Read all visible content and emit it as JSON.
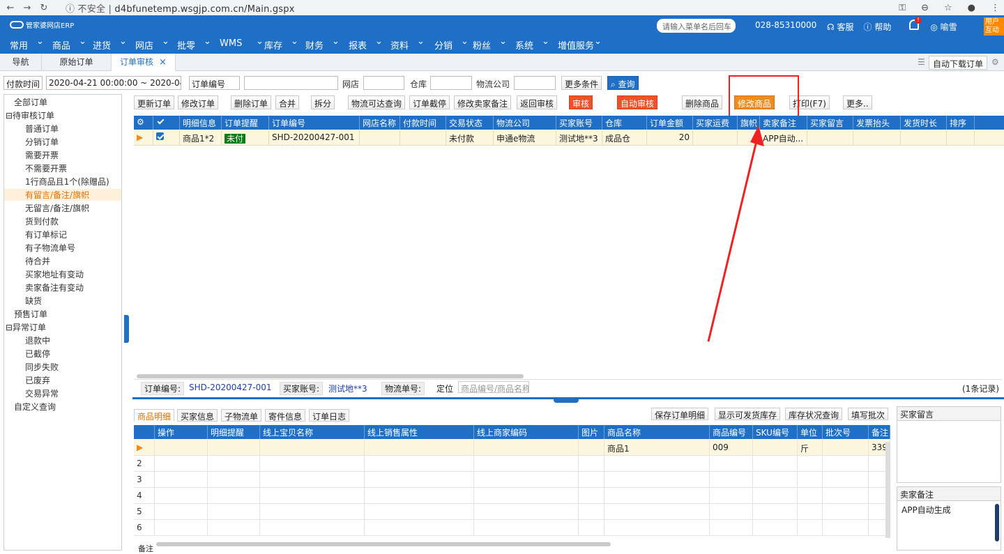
{
  "browser": {
    "back": "←",
    "forward": "→",
    "reload": "↻",
    "security": "不安全",
    "url": "d4bfunetemp.wsgjp.com.cn/Main.gspx"
  },
  "header": {
    "logo": "管家婆网店ERP",
    "search_placeholder": "请输入菜单名后回车",
    "phone": "028-85310000",
    "links": [
      "客服",
      "帮助",
      "喻雪"
    ],
    "user_badge": "用户\n互动",
    "notif_badge": "!",
    "menus": [
      "常用",
      "商品",
      "进货",
      "网店",
      "批零",
      "WMS",
      "库存",
      "财务",
      "报表",
      "资料",
      "分销",
      "粉丝",
      "系统",
      "增值服务"
    ]
  },
  "tabs": {
    "items": [
      "导航",
      "原始订单",
      "订单审核"
    ],
    "close": "×",
    "auto_download": "自动下载订单"
  },
  "filters": {
    "time_type": "付款时间",
    "date_range": "2020-04-21 00:00:00 ~ 2020-04-2",
    "field": "订单编号",
    "shop_label": "网店",
    "warehouse_label": "仓库",
    "logistics_label": "物流公司",
    "more": "更多条件",
    "query": "查询"
  },
  "toolbar": [
    "更新订单",
    "修改订单",
    "删除订单",
    "合并",
    "拆分",
    "物流可达查询",
    "订单截停",
    "修改卖家备注",
    "返回审核",
    "审核",
    "自动审核",
    "删除商品",
    "修改商品",
    "打印(F7)",
    "更多.."
  ],
  "sidebar": {
    "items": [
      {
        "label": "全部订单",
        "level": 0
      },
      {
        "label": "⊟待审核订单",
        "level": 0
      },
      {
        "label": "普通订单",
        "level": 1
      },
      {
        "label": "分销订单",
        "level": 1
      },
      {
        "label": "需要开票",
        "level": 1
      },
      {
        "label": "不需要开票",
        "level": 1
      },
      {
        "label": "1行商品且1个(除赠品)",
        "level": 1
      },
      {
        "label": "有留言/备注/旗帜",
        "level": 1,
        "selected": true
      },
      {
        "label": "无留言/备注/旗帜",
        "level": 1
      },
      {
        "label": "货到付款",
        "level": 1
      },
      {
        "label": "有订单标记",
        "level": 1
      },
      {
        "label": "有子物流单号",
        "level": 1
      },
      {
        "label": "待合并",
        "level": 1
      },
      {
        "label": "买家地址有变动",
        "level": 1
      },
      {
        "label": "卖家备注有变动",
        "level": 1
      },
      {
        "label": "缺货",
        "level": 1
      },
      {
        "label": "预售订单",
        "level": 0
      },
      {
        "label": "⊟异常订单",
        "level": 0
      },
      {
        "label": "退款中",
        "level": 1
      },
      {
        "label": "已截停",
        "level": 1
      },
      {
        "label": "同步失败",
        "level": 1
      },
      {
        "label": "已废弃",
        "level": 1
      },
      {
        "label": "交易异常",
        "level": 1
      },
      {
        "label": "自定义查询",
        "level": 0
      }
    ]
  },
  "order_grid": {
    "columns": [
      "⚙",
      "☑",
      "明细信息",
      "订单提醒",
      "订单编号",
      "网店名称",
      "付款时间",
      "交易状态",
      "物流公司",
      "买家账号",
      "仓库",
      "订单金额",
      "买家运费",
      "旗帜",
      "卖家备注",
      "买家留言",
      "发票抬头",
      "发货时长",
      "排序"
    ],
    "rows": [
      [
        "▶",
        "",
        "商品1*2",
        "未付",
        "SHD-20200427-001",
        "",
        "",
        "未付款",
        "申通e物流",
        "测试地**3",
        "成品仓",
        "20",
        "",
        "",
        "APP自动...",
        "",
        "",
        "",
        ""
      ]
    ]
  },
  "info_bar": {
    "order_no_label": "订单编号:",
    "order_no": "SHD-20200427-001",
    "buyer_label": "买家账号:",
    "buyer": "测试地**3",
    "logistics_label": "物流单号:",
    "locate_label": "定位",
    "locate_placeholder": "商品编号/商品名称",
    "count": "(1条记录)"
  },
  "detail_tabs": [
    "商品明细",
    "买家信息",
    "子物流单",
    "寄件信息",
    "订单日志"
  ],
  "detail_buttons": [
    "保存订单明细",
    "显示可发货库存",
    "库存状况查询",
    "填写批次"
  ],
  "detail_grid": {
    "columns": [
      "",
      "操作",
      "明细提醒",
      "线上宝贝名称",
      "线上销售属性",
      "线上商家编码",
      "图片",
      "商品名称",
      "商品编号",
      "SKU编号",
      "单位",
      "批次号",
      "备注"
    ],
    "rows": [
      [
        "▶",
        "",
        "",
        "",
        "",
        "",
        "",
        "商品1",
        "009",
        "",
        "斤",
        "",
        "339"
      ],
      [
        "2"
      ],
      [
        "3"
      ],
      [
        "4"
      ],
      [
        "5"
      ],
      [
        "6"
      ]
    ],
    "footer": "备注"
  },
  "buyer_message": {
    "title": "买家留言",
    "content": ""
  },
  "seller_note": {
    "title": "卖家备注",
    "content": "APP自动生成"
  }
}
